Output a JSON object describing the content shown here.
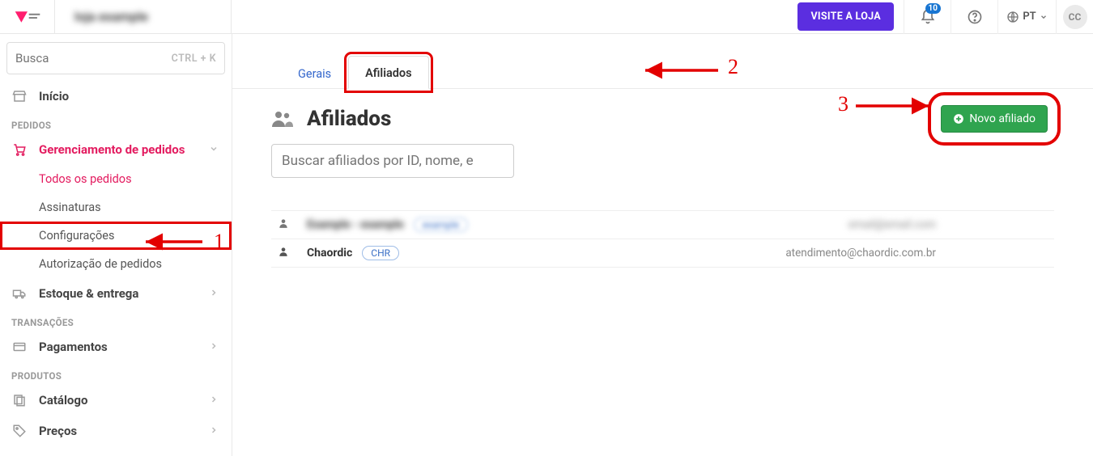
{
  "header": {
    "account_name": "loja example",
    "visit_store": "VISITE A LOJA",
    "notif_count": "10",
    "lang": "PT",
    "avatar_initials": "CC"
  },
  "sidebar": {
    "search_placeholder": "Busca",
    "search_kbd": "CTRL + K",
    "inicio": "Início",
    "section_pedidos": "PEDIDOS",
    "gerenciamento": "Gerenciamento de pedidos",
    "sub_todos": "Todos os pedidos",
    "sub_assinaturas": "Assinaturas",
    "sub_config": "Configurações",
    "sub_autorizacao": "Autorização de pedidos",
    "estoque": "Estoque & entrega",
    "section_trans": "TRANSAÇÕES",
    "pagamentos": "Pagamentos",
    "section_produtos": "PRODUTOS",
    "catalogo": "Catálogo",
    "precos": "Preços"
  },
  "tabs": {
    "gerais": "Gerais",
    "afiliados": "Afiliados"
  },
  "page": {
    "title": "Afiliados",
    "new_button": "Novo afiliado",
    "search_placeholder": "Buscar afiliados por ID, nome, e"
  },
  "rows": [
    {
      "name": "Example - example",
      "tag": "example",
      "email": "email@email.com",
      "blurred": true
    },
    {
      "name": "Chaordic",
      "tag": "CHR",
      "email": "atendimento@chaordic.com.br",
      "blurred": false
    }
  ],
  "annotations": {
    "n1": "1",
    "n2": "2",
    "n3": "3"
  }
}
